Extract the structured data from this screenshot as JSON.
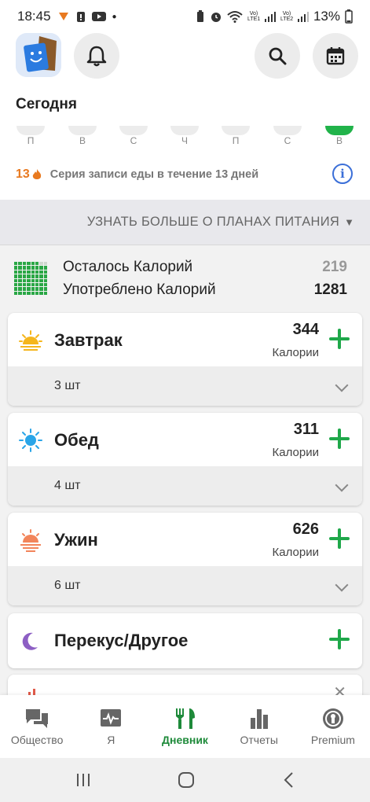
{
  "status_bar": {
    "time": "18:45",
    "battery": "13%",
    "lte1": "Vo) LTE1",
    "lte2": "Vo) LTE2"
  },
  "header": {
    "title": "Сегодня"
  },
  "week": {
    "days": [
      "П",
      "В",
      "С",
      "Ч",
      "П",
      "С",
      "В"
    ]
  },
  "streak": {
    "count": "13",
    "text": "Серия записи еды в течение 13 дней"
  },
  "learn_more": {
    "label": "УЗНАТЬ БОЛЬШЕ О ПЛАНАХ ПИТАНИЯ"
  },
  "summary": {
    "remaining_label": "Осталось Калорий",
    "remaining_value": "219",
    "consumed_label": "Употреблено Калорий",
    "consumed_value": "1281"
  },
  "meals": [
    {
      "name": "Завтрак",
      "calories": "344",
      "calories_label": "Калории",
      "count": "3 шт",
      "icon": "sunrise-icon"
    },
    {
      "name": "Обед",
      "calories": "311",
      "calories_label": "Калории",
      "count": "4 шт",
      "icon": "sun-icon"
    },
    {
      "name": "Ужин",
      "calories": "626",
      "calories_label": "Калории",
      "count": "6 шт",
      "icon": "sunset-icon"
    },
    {
      "name": "Перекус/Другое",
      "icon": "moon-icon"
    }
  ],
  "bottom_nav": [
    {
      "label": "Общество",
      "icon": "chat-icon",
      "active": false
    },
    {
      "label": "Я",
      "icon": "health-icon",
      "active": false
    },
    {
      "label": "Дневник",
      "icon": "fork-knife-icon",
      "active": true
    },
    {
      "label": "Отчеты",
      "icon": "bar-chart-icon",
      "active": false
    },
    {
      "label": "Premium",
      "icon": "premium-icon",
      "active": false
    }
  ],
  "colors": {
    "accent_green": "#1fa84a",
    "streak_orange": "#e8791f",
    "info_blue": "#3b6fd8"
  }
}
